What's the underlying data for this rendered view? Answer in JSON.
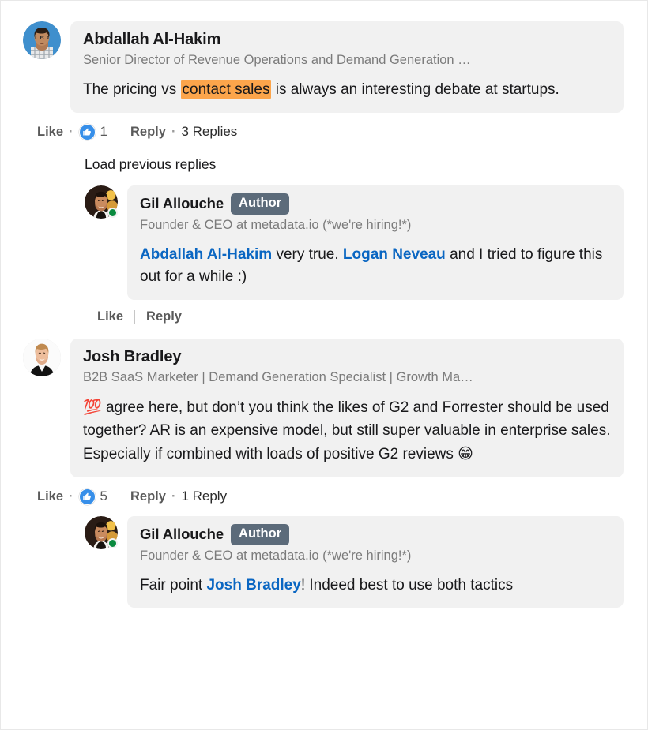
{
  "colors": {
    "bubble_bg": "#f1f1f1",
    "mention_blue": "#0a66c2",
    "highlight_orange": "#fca54b",
    "author_badge_bg": "#5c6b7a",
    "like_blue": "#378fe9",
    "online_green": "#0a8a3f",
    "text_primary": "#19191b",
    "text_muted": "#7b7b7b"
  },
  "comments": [
    {
      "id": "comment-abdallah",
      "author": "Abdallah Al-Hakim",
      "headline": "Senior Director of Revenue Operations and Demand Generation …",
      "avatar_name": "avatar-abdallah-al-hakim",
      "is_author_badge": false,
      "online": false,
      "body_segments": [
        {
          "type": "text",
          "text": "The pricing vs "
        },
        {
          "type": "highlight",
          "text": "contact sales"
        },
        {
          "type": "text",
          "text": " is always an interesting debate at startups."
        }
      ],
      "actions": {
        "like_label": "Like",
        "separator": "·",
        "reaction_icon": "thumbs-up-icon",
        "reaction_count": "1",
        "reply_label": "Reply",
        "replies_label": "3 Replies"
      }
    },
    {
      "id": "reply-gil-1",
      "author": "Gil Allouche",
      "author_badge": "Author",
      "headline": "Founder & CEO at metadata.io (*we're hiring!*)",
      "avatar_name": "avatar-gil-allouche",
      "is_author_badge": true,
      "online": true,
      "body_segments": [
        {
          "type": "mention",
          "text": "Abdallah Al-Hakim"
        },
        {
          "type": "text",
          "text": " very true. "
        },
        {
          "type": "mention",
          "text": "Logan Neveau"
        },
        {
          "type": "text",
          "text": " and I tried to figure this out for a while :)"
        }
      ],
      "actions": {
        "like_label": "Like",
        "reply_label": "Reply"
      }
    },
    {
      "id": "comment-josh",
      "author": "Josh Bradley",
      "headline": "B2B SaaS Marketer | Demand Generation Specialist | Growth Ma…",
      "avatar_name": "avatar-josh-bradley",
      "is_author_badge": false,
      "online": false,
      "body_segments": [
        {
          "type": "emoji",
          "text": "💯"
        },
        {
          "type": "text",
          "text": " agree here, but don’t you think the likes of G2 and Forrester should be used together? AR is an expensive model, but still super valuable in enterprise sales. Especially if combined with loads of positive G2 reviews "
        },
        {
          "type": "emoji",
          "text": "😁"
        }
      ],
      "actions": {
        "like_label": "Like",
        "separator": "·",
        "reaction_icon": "thumbs-up-icon",
        "reaction_count": "5",
        "reply_label": "Reply",
        "replies_label": "1 Reply"
      }
    },
    {
      "id": "reply-gil-2",
      "author": "Gil Allouche",
      "author_badge": "Author",
      "headline": "Founder & CEO at metadata.io (*we're hiring!*)",
      "avatar_name": "avatar-gil-allouche",
      "is_author_badge": true,
      "online": true,
      "body_segments": [
        {
          "type": "text",
          "text": "Fair point "
        },
        {
          "type": "mention",
          "text": "Josh Bradley"
        },
        {
          "type": "text",
          "text": "! Indeed best to use both tactics"
        }
      ]
    }
  ],
  "load_previous": {
    "label": "Load previous replies"
  }
}
